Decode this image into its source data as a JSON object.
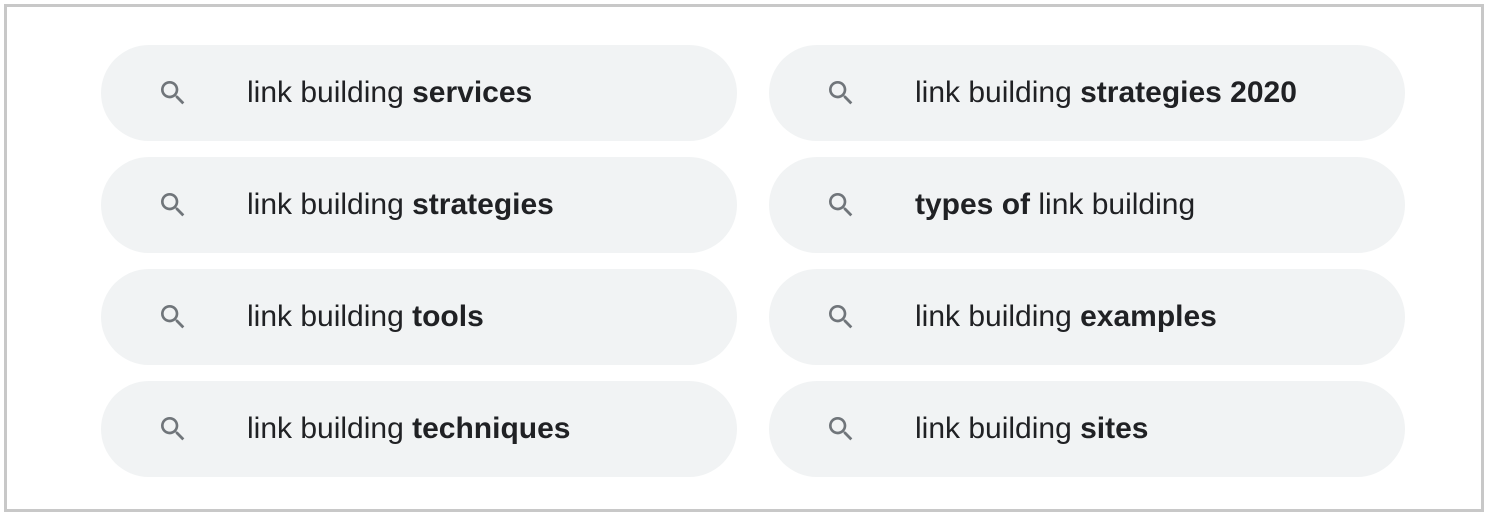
{
  "related_searches": [
    {
      "prefix": "link building ",
      "bold": "services",
      "suffix": ""
    },
    {
      "prefix": "link building ",
      "bold": "strategies 2020",
      "suffix": ""
    },
    {
      "prefix": "link building ",
      "bold": "strategies",
      "suffix": ""
    },
    {
      "prefix": "",
      "bold": "types of",
      "suffix": " link building"
    },
    {
      "prefix": "link building ",
      "bold": "tools",
      "suffix": ""
    },
    {
      "prefix": "link building ",
      "bold": "examples",
      "suffix": ""
    },
    {
      "prefix": "link building ",
      "bold": "techniques",
      "suffix": ""
    },
    {
      "prefix": "link building ",
      "bold": "sites",
      "suffix": ""
    }
  ],
  "icon": "search-icon",
  "colors": {
    "chip_background": "#f1f3f4",
    "text": "#202124",
    "icon": "#70757a",
    "frame_border": "#c8c8c8"
  }
}
